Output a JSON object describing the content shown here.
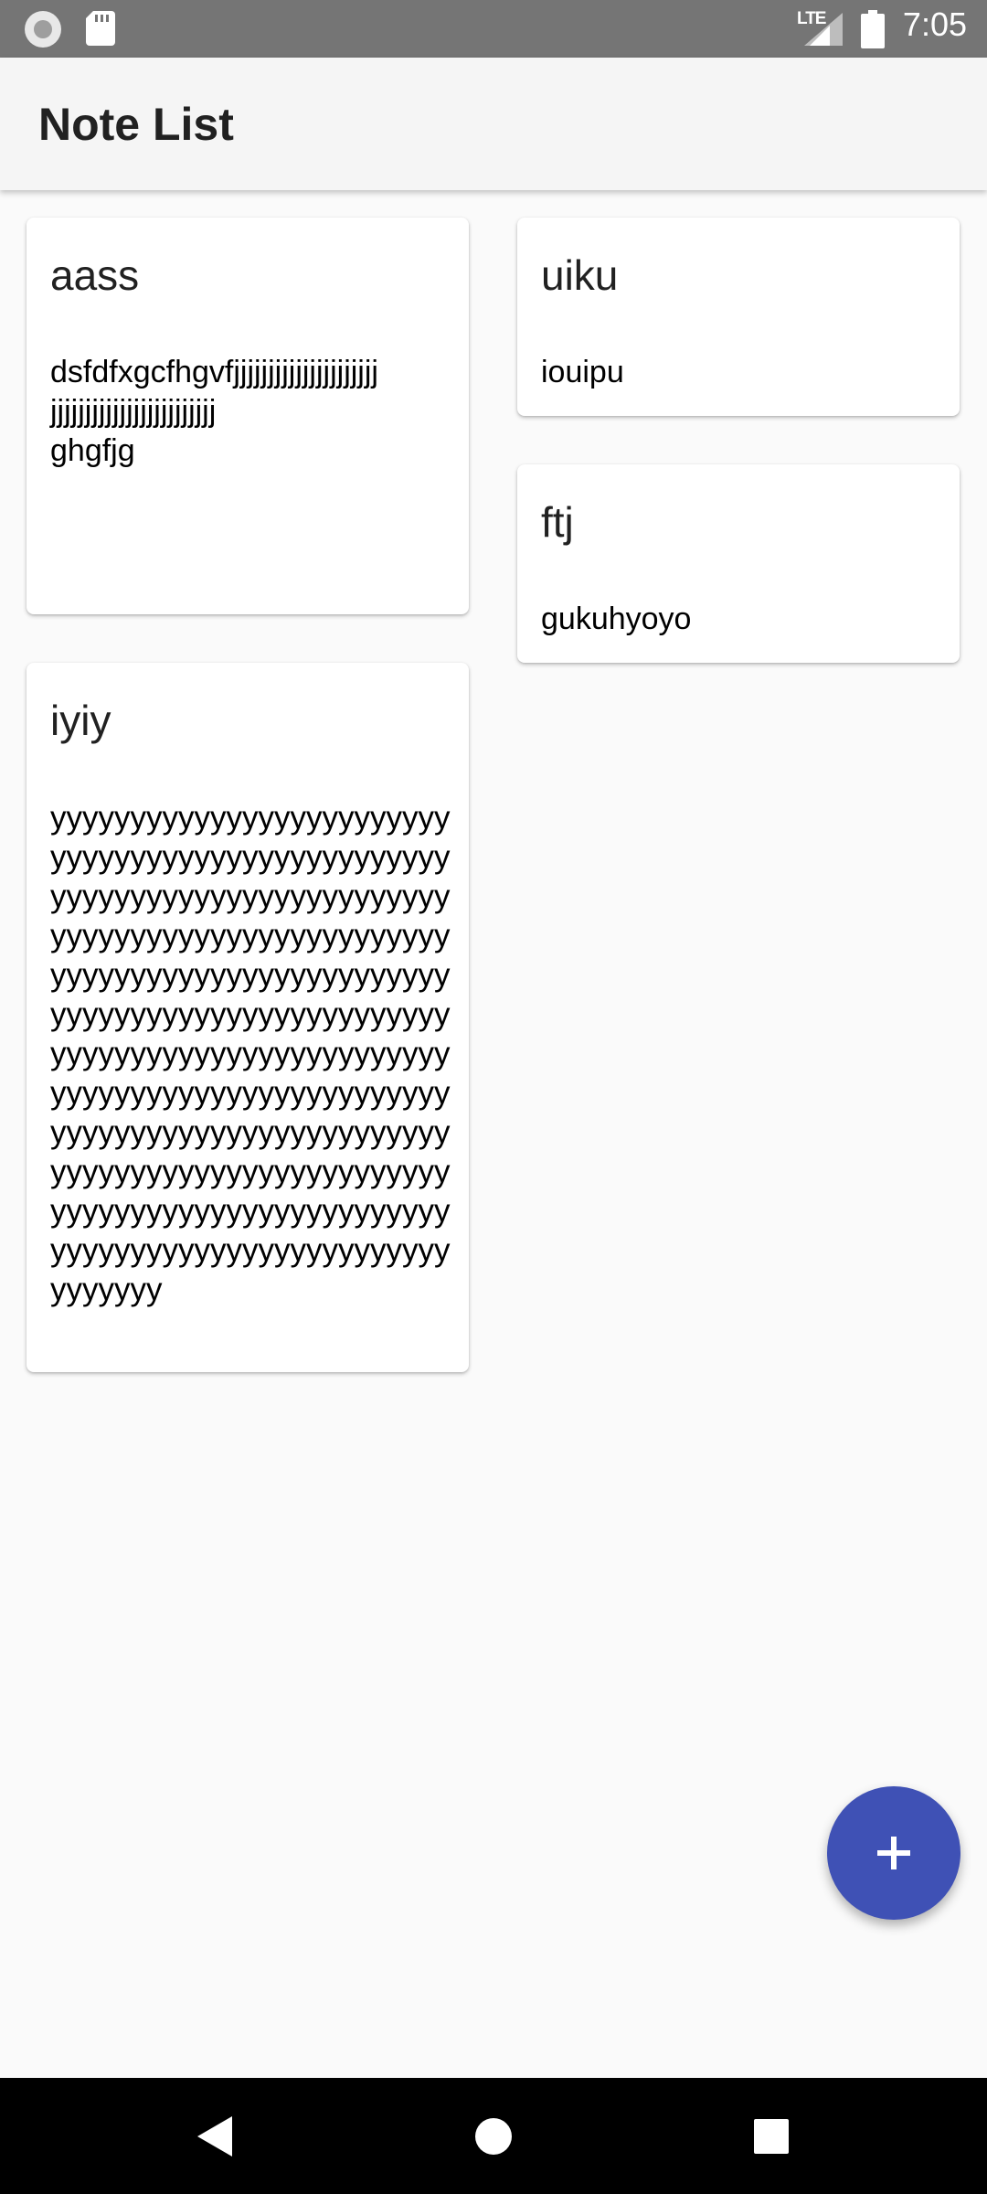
{
  "status_bar": {
    "time": "7:05",
    "network_label": "LTE",
    "icons": [
      "record-icon",
      "sd-card-icon",
      "signal-icon",
      "battery-icon"
    ]
  },
  "app_bar": {
    "title": "Note List"
  },
  "notes": [
    {
      "title": "aass",
      "body": "dsfdfxgcfhgvfjjjjjjjjjjjjjjjjjjjjj\njjjjjjjjjjjjjjjjjjjjjjjj\nghgfjg"
    },
    {
      "title": "uiku",
      "body": "iouipu"
    },
    {
      "title": "ftj",
      "body": "gukuhyoyo"
    },
    {
      "title": "iyiy",
      "body": "yyyyyyyyyyyyyyyyyyyyyyyyyyyyyyyyyyyyyyyyyyyyyyyyyyyyyyyyyyyyyyyyyyyyyyyyyyyyyyyyyyyyyyyyyyyyyyyyyyyyyyyyyyyyyyyyyyyyyyyyyyyyyyyyyyyyyyyyyyyyyyyyyyyyyyyyyyyyyyyyyyyyyyyyyyyyyyyyyyyyyyyyyyyyyyyyyyyyyyyyyyyyyyyyyyyyyyyyyyyyyyyyyyyyyyyyyyyyyyyyyyyyyyyyyyyyyyyyyyyyyyyyyyyyyyyyyyyyyyyyyyyyyyyyyyyyyyyyyyyyyyyyyyy"
    }
  ],
  "fab": {
    "icon": "plus-icon",
    "color": "#3f51b5"
  },
  "nav_bar": {
    "icons": [
      "back-icon",
      "home-icon",
      "recents-icon"
    ]
  }
}
